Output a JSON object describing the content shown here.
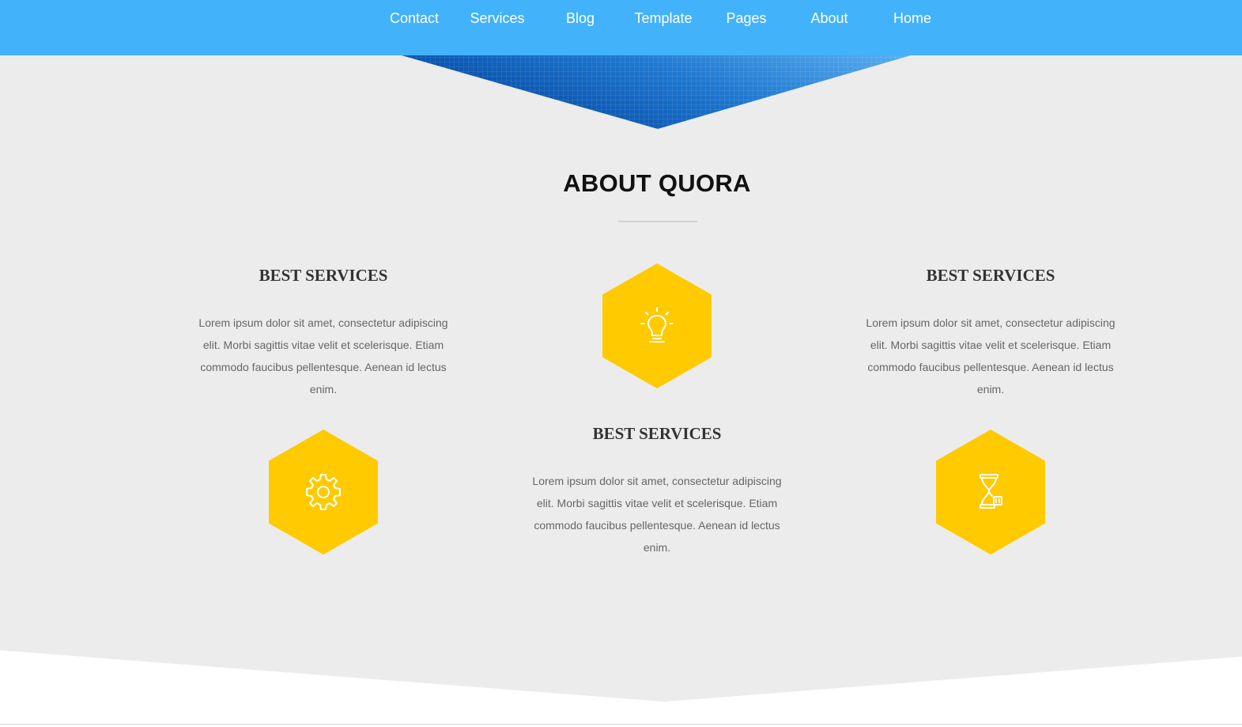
{
  "nav": {
    "items": [
      "Contact",
      "Services",
      "Blog",
      "Template",
      "Pages",
      "About",
      "Home"
    ]
  },
  "about": {
    "title": "ABOUT QUORA",
    "services": [
      {
        "title": "BEST SERVICES",
        "text": "Lorem ipsum dolor sit amet, consectetur adipiscing elit. Morbi sagittis vitae velit et scelerisque. Etiam commodo faucibus pellentesque. Aenean id lectus enim.",
        "icon": "gear-icon"
      },
      {
        "title": "BEST SERVICES",
        "text": "Lorem ipsum dolor sit amet, consectetur adipiscing elit. Morbi sagittis vitae velit et scelerisque. Etiam commodo faucibus pellentesque. Aenean id lectus enim.",
        "icon": "lightbulb-icon"
      },
      {
        "title": "BEST SERVICES",
        "text": "Lorem ipsum dolor sit amet, consectetur adipiscing elit. Morbi sagittis vitae velit et scelerisque. Etiam commodo faucibus pellentesque. Aenean id lectus enim.",
        "icon": "hourglass-icon"
      }
    ]
  },
  "colors": {
    "navbar": "#42b2fb",
    "accent_hex": "#ffca00",
    "section_bg": "#ececec"
  }
}
